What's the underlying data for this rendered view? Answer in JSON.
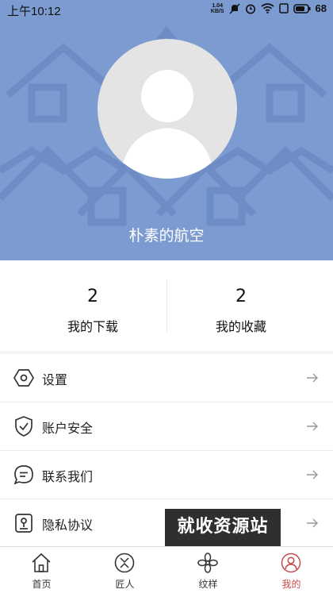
{
  "status_bar": {
    "time": "上午10:12",
    "network_speed_value": "1.04",
    "network_speed_unit": "KB/S",
    "battery": "68"
  },
  "profile": {
    "username": "朴素的航空"
  },
  "stats": [
    {
      "count": "2",
      "label": "我的下载"
    },
    {
      "count": "2",
      "label": "我的收藏"
    }
  ],
  "menu": [
    {
      "label": "设置",
      "icon": "settings-hexagon-icon"
    },
    {
      "label": "账户安全",
      "icon": "shield-check-icon"
    },
    {
      "label": "联系我们",
      "icon": "chat-bubble-icon"
    },
    {
      "label": "隐私协议",
      "icon": "privacy-document-icon"
    }
  ],
  "watermark": "就收资源站",
  "tabbar": [
    {
      "label": "首页",
      "icon": "home-icon"
    },
    {
      "label": "匠人",
      "icon": "craftsman-icon"
    },
    {
      "label": "纹样",
      "icon": "flower-pattern-icon"
    },
    {
      "label": "我的",
      "icon": "user-icon",
      "active": true
    }
  ],
  "colors": {
    "header_bg": "#7b9bd1",
    "active_tab": "#c94b4b",
    "accent_text": "#111111"
  }
}
